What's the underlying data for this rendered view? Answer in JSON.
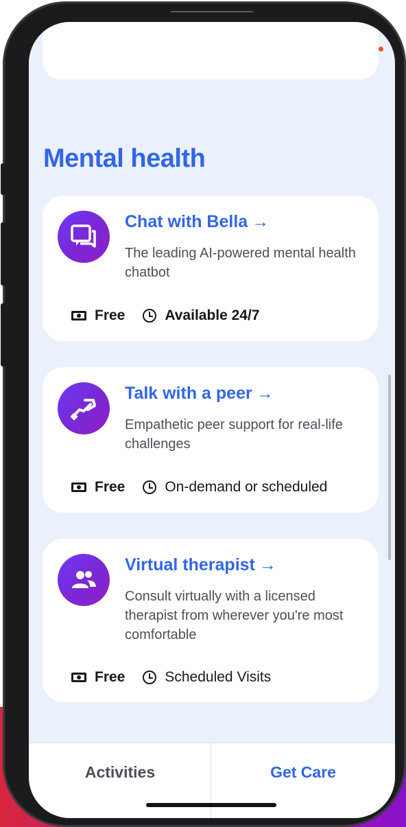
{
  "section": {
    "title": "Mental health"
  },
  "services": [
    {
      "icon": "chat-bubbles-icon",
      "title": "Chat with Bella",
      "arrow": "→",
      "description": "The leading AI-powered mental health chatbot",
      "price": "Free",
      "availability": "Available 24/7"
    },
    {
      "icon": "handshake-icon",
      "title": "Talk with a peer",
      "arrow": "→",
      "description": "Empathetic peer support for real-life challenges",
      "price": "Free",
      "availability": "On-demand or scheduled"
    },
    {
      "icon": "people-icon",
      "title": "Virtual therapist",
      "arrow": "→",
      "description": "Consult virtually with a licensed therapist from wherever you're most comfortable",
      "price": "Free",
      "availability": "Scheduled Visits"
    }
  ],
  "tabs": [
    {
      "label": "Activities",
      "active": false
    },
    {
      "label": "Get Care",
      "active": true
    }
  ],
  "colors": {
    "accent": "#3366e6",
    "background": "#ebf0fd",
    "icon_gradient_start": "#6a3bf2",
    "icon_gradient_end": "#8f1fc7"
  }
}
